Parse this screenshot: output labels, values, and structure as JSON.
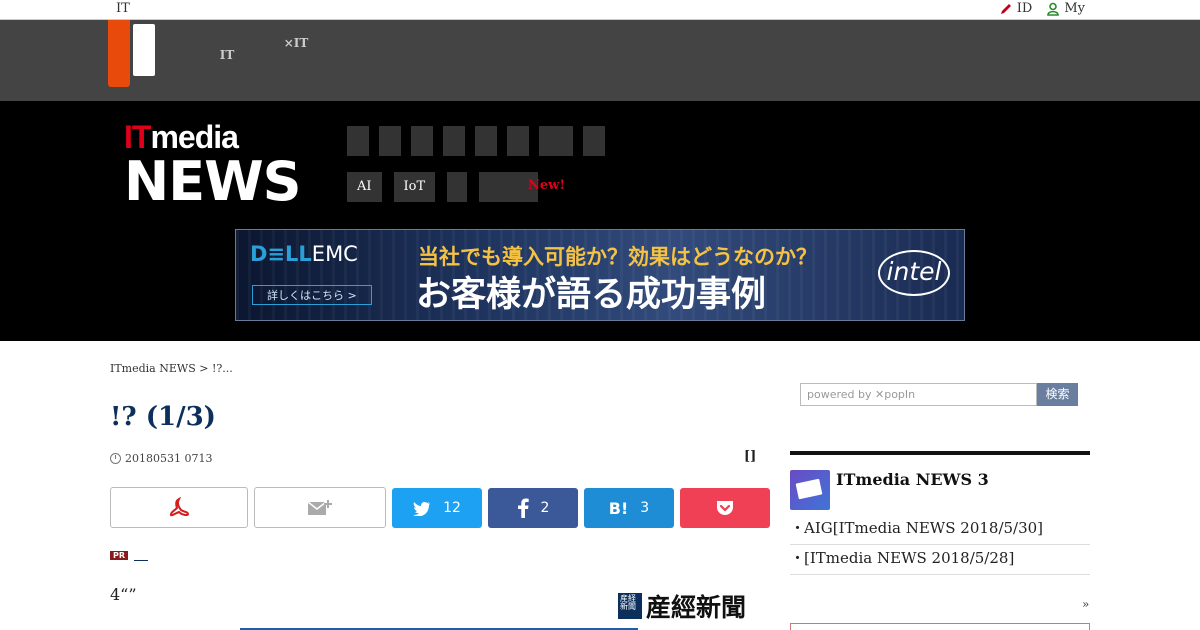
{
  "topbar": {
    "site": "IT",
    "right": [
      {
        "icon": "pencil-icon",
        "label": "ID"
      },
      {
        "icon": "user-icon",
        "label": "My"
      }
    ]
  },
  "header": {
    "grey_links": [
      {
        "line1": "",
        "line2": "IT"
      },
      {
        "line1": "",
        "line2": "×IT"
      }
    ]
  },
  "brand": {
    "top": "ITmedia",
    "bottom": "NEWS"
  },
  "nav": {
    "row2": [
      "AI",
      "IoT",
      "",
      ""
    ],
    "new_label": "New!"
  },
  "banner": {
    "brand": "DELLEMC",
    "cta": "詳しくはこちら >",
    "headline1": "当社でも導入可能か？効果はどうなのか？",
    "headline2": "お客様が語る成功事例",
    "partner": "intel"
  },
  "article": {
    "breadcrumb": "ITmedia NEWS > !?...",
    "title": "!? (1/3)",
    "date": "20180531 0713",
    "bracket": "[]",
    "shares": {
      "twitter": "12",
      "facebook": "2",
      "hatena": "3"
    },
    "pr_badge": "PR",
    "lead": "4“”",
    "source": "産經新聞",
    "source_box": "産経新聞"
  },
  "sidebar": {
    "search_placeholder": "powered by ✕popIn",
    "search_button": "検索",
    "ranking_title": "ITmedia NEWS 3",
    "items": [
      "AIG[ITmedia NEWS 2018/5/30]",
      "[ITmedia NEWS   2018/5/28]"
    ],
    "more": "»"
  },
  "colors": {
    "accent": "#e84a0c",
    "title": "#0c2f5c",
    "twitter": "#1da1f2",
    "facebook": "#3b5998",
    "hatena": "#1f8dd6",
    "pocket": "#ef4056"
  }
}
